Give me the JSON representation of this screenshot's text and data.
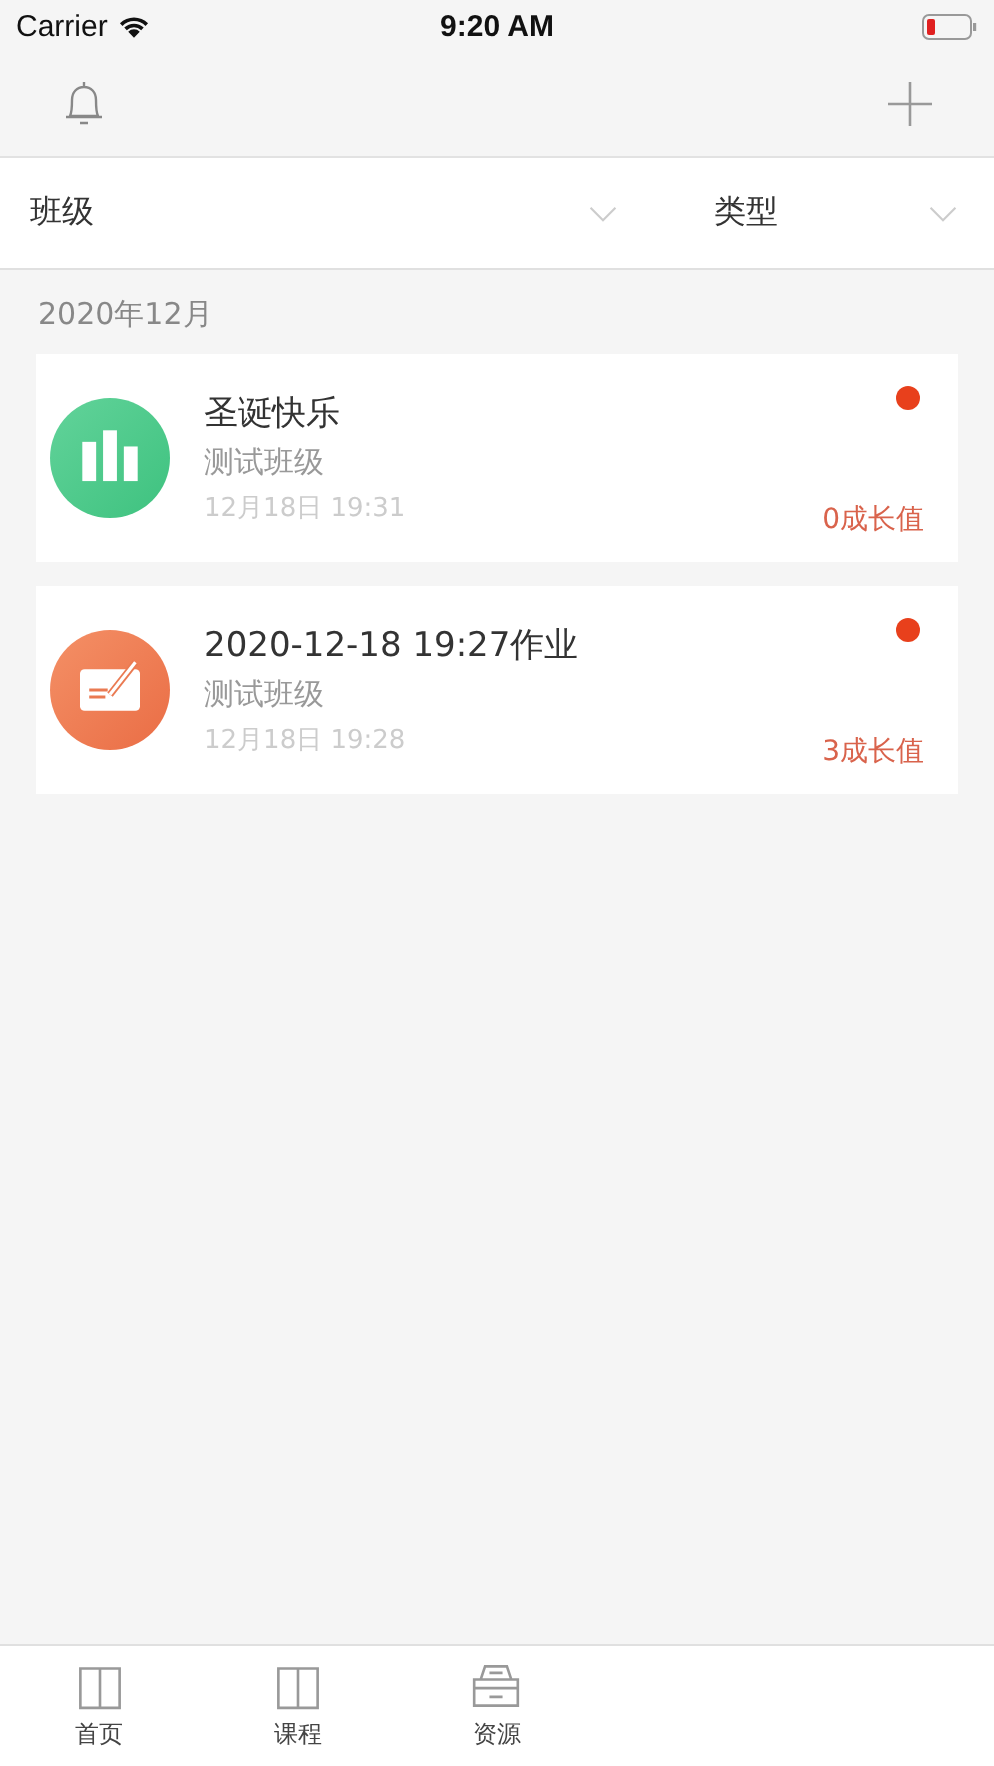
{
  "status_bar": {
    "carrier": "Carrier",
    "time": "9:20 AM"
  },
  "filters": [
    {
      "label": "班级"
    },
    {
      "label": "类型"
    }
  ],
  "section": {
    "title": "2020年12月"
  },
  "messages": [
    {
      "kind": "chart",
      "title": "圣诞快乐",
      "class_name": "测试班级",
      "time": "12月18日 19:31",
      "points": "0成长值",
      "unread": true
    },
    {
      "kind": "homework",
      "title": "2020-12-18 19:27作业",
      "class_name": "测试班级",
      "time": "12月18日 19:28",
      "points": "3成长值",
      "unread": true
    }
  ],
  "tab_bar": [
    {
      "label": "首页",
      "kind": "book"
    },
    {
      "label": "课程",
      "kind": "book"
    },
    {
      "label": "资源",
      "kind": "tray"
    }
  ]
}
